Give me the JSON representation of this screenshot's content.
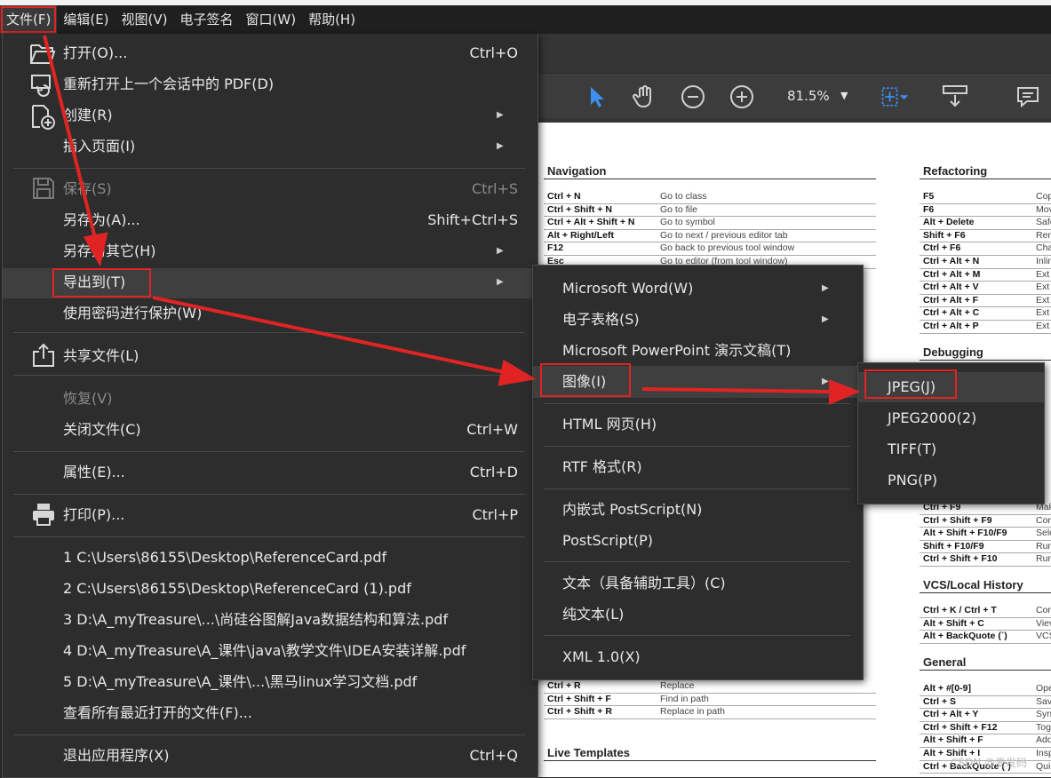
{
  "menubar": [
    "文件(F)",
    "编辑(E)",
    "视图(V)",
    "电子签名",
    "窗口(W)",
    "帮助(H)"
  ],
  "toolbar": {
    "zoom": "81.5%"
  },
  "file_menu": {
    "open": {
      "label": "打开(O)...",
      "shortcut": "Ctrl+O"
    },
    "reopen": {
      "label": "重新打开上一个会话中的 PDF(D)"
    },
    "create": {
      "label": "创建(R)"
    },
    "insert": {
      "label": "插入页面(I)"
    },
    "save": {
      "label": "保存(S)",
      "shortcut": "Ctrl+S"
    },
    "save_as": {
      "label": "另存为(A)...",
      "shortcut": "Shift+Ctrl+S"
    },
    "save_other": {
      "label": "另存为其它(H)"
    },
    "export": {
      "label": "导出到(T)"
    },
    "protect": {
      "label": "使用密码进行保护(W)"
    },
    "share": {
      "label": "共享文件(L)"
    },
    "revert": {
      "label": "恢复(V)"
    },
    "close": {
      "label": "关闭文件(C)",
      "shortcut": "Ctrl+W"
    },
    "properties": {
      "label": "属性(E)...",
      "shortcut": "Ctrl+D"
    },
    "print": {
      "label": "打印(P)...",
      "shortcut": "Ctrl+P"
    },
    "recent": [
      "1 C:\\Users\\86155\\Desktop\\ReferenceCard.pdf",
      "2 C:\\Users\\86155\\Desktop\\ReferenceCard (1).pdf",
      "3 D:\\A_myTreasure\\...\\尚硅谷图解Java数据结构和算法.pdf",
      "4 D:\\A_myTreasure\\A_课件\\java\\教学文件\\IDEA安装详解.pdf",
      "5 D:\\A_myTreasure\\A_课件\\...\\黑马linux学习文档.pdf"
    ],
    "view_all_recent": {
      "label": "查看所有最近打开的文件(F)..."
    },
    "exit": {
      "label": "退出应用程序(X)",
      "shortcut": "Ctrl+Q"
    }
  },
  "export_menu": [
    "Microsoft Word(W)",
    "电子表格(S)",
    "Microsoft PowerPoint 演示文稿(T)",
    "图像(I)",
    "HTML 网页(H)",
    "RTF 格式(R)",
    "内嵌式 PostScript(N)",
    "PostScript(P)",
    "文本（具备辅助工具）(C)",
    "纯文本(L)",
    "XML 1.0(X)"
  ],
  "image_menu": [
    "JPEG(J)",
    "JPEG2000(2)",
    "TIFF(T)",
    "PNG(P)"
  ],
  "doc": {
    "navigation": {
      "title": "Navigation",
      "rows": [
        [
          "Ctrl + N",
          "Go to class"
        ],
        [
          "Ctrl + Shift + N",
          "Go to file"
        ],
        [
          "Ctrl + Alt + Shift + N",
          "Go to symbol"
        ],
        [
          "Alt + Right/Left",
          "Go to next / previous editor tab"
        ],
        [
          "F12",
          "Go back to previous tool window"
        ],
        [
          "Esc",
          "Go to editor (from tool window)"
        ]
      ]
    },
    "refactoring": {
      "title": "Refactoring",
      "rows": [
        [
          "F5",
          "Cop"
        ],
        [
          "F6",
          "Mov"
        ],
        [
          "Alt + Delete",
          "Safe"
        ],
        [
          "Shift + F6",
          "Ren"
        ],
        [
          "Ctrl + F6",
          "Cha"
        ],
        [
          "Ctrl + Alt + N",
          "Inlin"
        ],
        [
          "Ctrl + Alt + M",
          "Ext"
        ],
        [
          "Ctrl + Alt + V",
          "Ext"
        ],
        [
          "Ctrl + Alt + F",
          "Ext"
        ],
        [
          "Ctrl + Alt + C",
          "Ext"
        ],
        [
          "Ctrl + Alt + P",
          "Ext"
        ]
      ]
    },
    "debugging": {
      "title": "Debugging"
    },
    "debug_rows": [
      [
        "Ctrl + F9",
        "Mak"
      ],
      [
        "Ctrl + Shift + F9",
        "Cor"
      ],
      [
        "Alt + Shift + F10/F9",
        "Sele"
      ],
      [
        "Shift + F10/F9",
        "Run"
      ],
      [
        "Ctrl + Shift + F10",
        "Run"
      ]
    ],
    "vcs": {
      "title": "VCS/Local History",
      "rows": [
        [
          "Ctrl + K / Ctrl + T",
          "Cor"
        ],
        [
          "Alt + Shift + C",
          "Viev"
        ],
        [
          "Alt + BackQuote (`)",
          "VCS"
        ]
      ]
    },
    "general": {
      "title": "General",
      "rows": [
        [
          "Alt + #[0-9]",
          "Ope"
        ],
        [
          "Ctrl + S",
          "Sav"
        ],
        [
          "Ctrl + Alt + Y",
          "Syn"
        ],
        [
          "Ctrl + Shift + F12",
          "Tog"
        ],
        [
          "Alt + Shift + F",
          "Add"
        ],
        [
          "Alt + Shift + I",
          "Insp"
        ],
        [
          "Ctrl + BackQuote (`)",
          "Quic"
        ]
      ]
    },
    "replace_rows": [
      [
        "Ctrl + R",
        "Replace"
      ],
      [
        "Ctrl + Shift + F",
        "Find in path"
      ],
      [
        "Ctrl + Shift + R",
        "Replace in path"
      ]
    ],
    "live_templates": {
      "title": "Live Templates"
    }
  },
  "watermark": "CSDN @麦发码",
  "colors": {
    "annotation_red": "#e02424",
    "menu_bg": "#2d2d2d",
    "cursor_blue": "#3d8ff0"
  }
}
